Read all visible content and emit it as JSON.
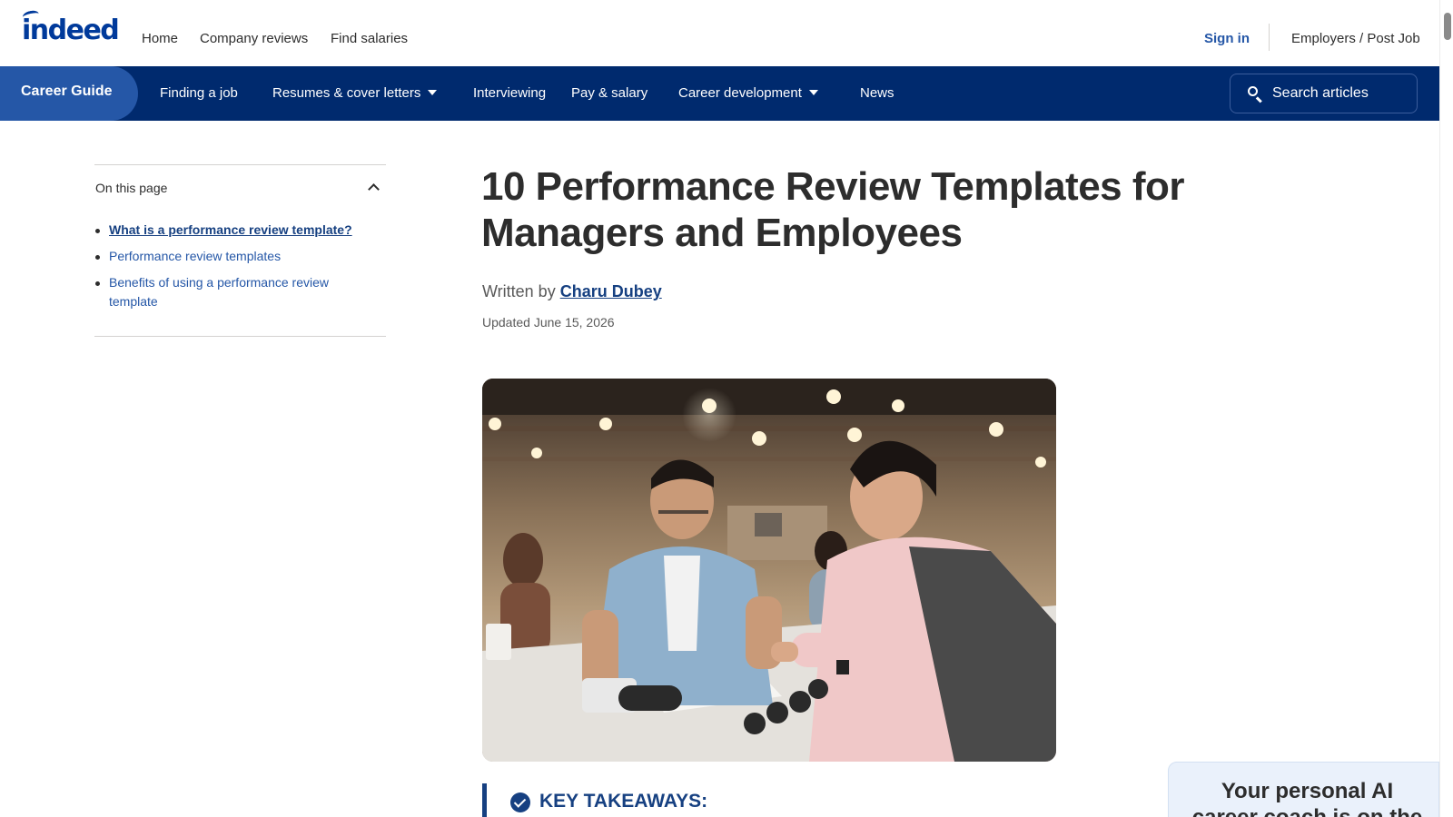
{
  "header": {
    "logo_text": "indeed",
    "nav": [
      {
        "label": "Home"
      },
      {
        "label": "Company reviews"
      },
      {
        "label": "Find salaries"
      }
    ],
    "sign_in": "Sign in",
    "employers": "Employers / Post Job"
  },
  "career_nav": {
    "brand": "Career Guide",
    "items": [
      {
        "label": "Finding a job",
        "dropdown": false
      },
      {
        "label": "Resumes & cover letters",
        "dropdown": true
      },
      {
        "label": "Interviewing",
        "dropdown": false
      },
      {
        "label": "Pay & salary",
        "dropdown": false
      },
      {
        "label": "Career development",
        "dropdown": true
      },
      {
        "label": "News",
        "dropdown": false
      }
    ],
    "search_placeholder": "Search articles"
  },
  "toc": {
    "title": "On this page",
    "items": [
      {
        "label": "What is a performance review template?",
        "active": true
      },
      {
        "label": "Performance review templates",
        "active": false
      },
      {
        "label": "Benefits of using a performance review template",
        "active": false
      }
    ]
  },
  "article": {
    "title": "10 Performance Review Templates for Managers and Employees",
    "written_by": "Written by ",
    "author": "Charu Dubey",
    "updated": "Updated June 15, 2026",
    "key_takeaways": "KEY TAKEAWAYS:"
  },
  "ai_card": {
    "text": "Your personal AI career coach is on the"
  },
  "colors": {
    "brand_blue": "#2557a7",
    "nav_navy": "#002a6e",
    "link_dark": "#164081"
  },
  "icons": [
    "search-icon",
    "chevron-up-icon",
    "caret-down-icon",
    "check-circle-icon"
  ]
}
